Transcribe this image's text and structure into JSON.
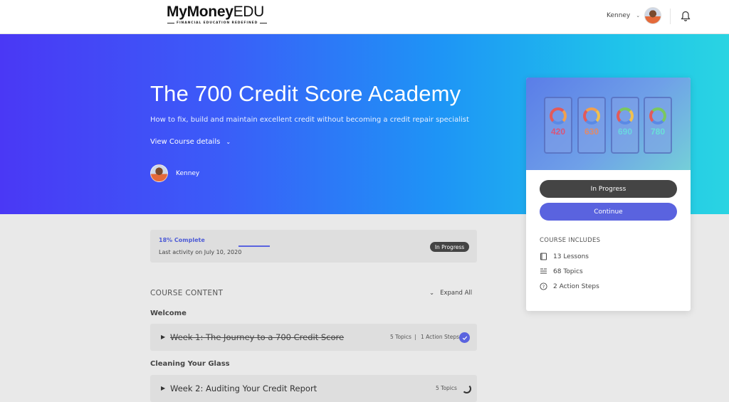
{
  "header": {
    "logo_bold": "MyMoney",
    "logo_light": "EDU",
    "logo_tagline": "FINANCIAL EDUCATION REDEFINED",
    "user_name": "Kenney"
  },
  "hero": {
    "title": "The 700 Credit Score Academy",
    "subtitle": "How to fix, build and maintain excellent credit without becoming a credit repair specialist",
    "view_details": "View Course details",
    "author": "Kenney"
  },
  "sidebar": {
    "thumbnail_scores": [
      "420",
      "630",
      "690",
      "780"
    ],
    "status_button": "In Progress",
    "continue_button": "Continue",
    "includes_title": "COURSE INCLUDES",
    "includes": [
      {
        "icon": "book-icon",
        "label": "13 Lessons"
      },
      {
        "icon": "topics-list-icon",
        "label": "68 Topics"
      },
      {
        "icon": "question-circle-icon",
        "label": "2 Action Steps"
      }
    ]
  },
  "progress": {
    "percent_label": "18% Complete",
    "percent": 18,
    "last_activity": "Last activity on July 10, 2020",
    "status": "In Progress"
  },
  "content": {
    "title": "COURSE CONTENT",
    "expand_all": "Expand All",
    "sections": [
      {
        "heading": "Welcome",
        "lessons": [
          {
            "title": "Week 1: The Journey to a 700 Credit Score",
            "topics": "5 Topics",
            "separator": "|",
            "steps": "1 Action Steps",
            "status": "complete"
          }
        ]
      },
      {
        "heading": "Cleaning Your Glass",
        "lessons": [
          {
            "title": "Week 2: Auditing Your Credit Report",
            "topics": "5 Topics",
            "status": "in-progress"
          }
        ]
      }
    ]
  },
  "colors": {
    "accent": "#5a63df",
    "hero_start": "#4a38f5",
    "hero_end": "#2ad4e2",
    "dark_button": "#444444"
  }
}
